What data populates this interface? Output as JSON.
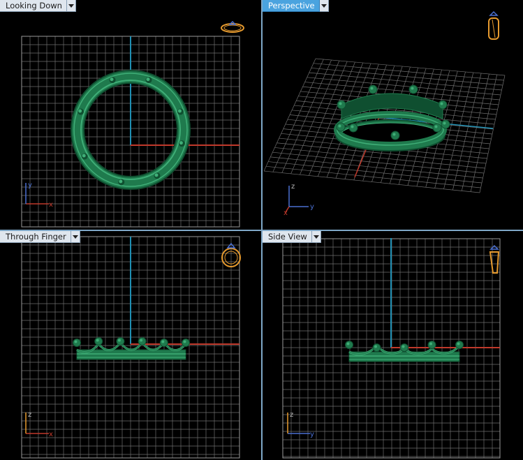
{
  "viewports": [
    {
      "id": "top-left",
      "title": "Looking Down",
      "active": false,
      "axis_h": "x",
      "axis_v": "y"
    },
    {
      "id": "top-right",
      "title": "Perspective",
      "active": true,
      "axis_h": "y",
      "axis_v": "z",
      "axis_x": "x"
    },
    {
      "id": "bottom-left",
      "title": "Through Finger",
      "active": false,
      "axis_h": "x",
      "axis_v": "z"
    },
    {
      "id": "bottom-right",
      "title": "Side View",
      "active": false,
      "axis_h": "y",
      "axis_v": "z"
    }
  ],
  "colors": {
    "grid": "#6e6e6e",
    "grid_major": "#9a9a9a",
    "axis_blue": "#1f8fb3",
    "axis_red": "#c0392b",
    "model": "#1f7a4d",
    "model_light": "#3fae77",
    "model_dark": "#0f4f30",
    "gizmo": "#e69a2e",
    "gizmo_blue": "#4a6fd1"
  }
}
